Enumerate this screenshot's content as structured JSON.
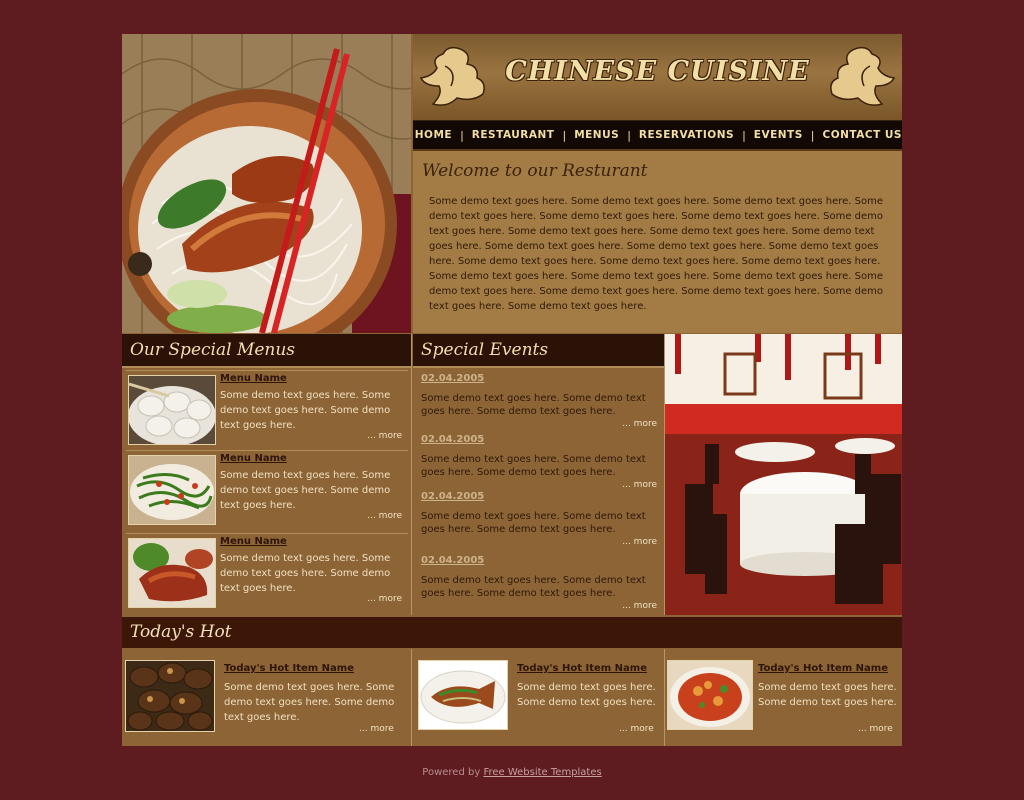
{
  "header": {
    "logo": "CHINESE CUISINE"
  },
  "nav": [
    "HOME",
    "RESTAURANT",
    "MENUS",
    "RESERVATIONS",
    "EVENTS",
    "CONTACT US"
  ],
  "welcome": {
    "title": "Welcome to our Resturant",
    "text": "Some demo text goes here. Some demo text goes here. Some demo text goes here. Some demo text goes here. Some demo text goes here. Some demo text goes here. Some demo text goes here. Some demo text goes here. Some demo text goes here. Some demo text goes here. Some demo text goes here. Some demo text goes here. Some demo text goes here. Some demo text goes here. Some demo text goes here. Some demo text goes here. Some demo text goes here. Some demo text goes here. Some demo text goes here. Some demo text goes here. Some demo text goes here. Some demo text goes here. Some demo text goes here. Some demo text goes here."
  },
  "special_menus": {
    "title": "Our Special Menus",
    "items": [
      {
        "name": "Menu Name",
        "text": "Some demo text goes here. Some demo text goes here. Some demo text goes here.",
        "more": "... more",
        "image": "dumplings-photo"
      },
      {
        "name": "Menu Name",
        "text": "Some demo text goes here. Some demo text goes here. Some demo text goes here.",
        "more": "... more",
        "image": "stir-fried-greens-photo"
      },
      {
        "name": "Menu Name",
        "text": "Some demo text goes here. Some demo text goes here. Some demo text goes here.",
        "more": "... more",
        "image": "roast-duck-photo"
      }
    ]
  },
  "special_events": {
    "title": "Special Events",
    "items": [
      {
        "date": "02.04.2005",
        "text": "Some demo text goes here. Some demo text goes here. Some demo text goes here.",
        "more": "... more"
      },
      {
        "date": "02.04.2005",
        "text": "Some demo text goes here. Some demo text goes here. Some demo text goes here.",
        "more": "... more"
      },
      {
        "date": "02.04.2005",
        "text": "Some demo text goes here. Some demo text goes here. Some demo text goes here.",
        "more": "... more"
      },
      {
        "date": "02.04.2005",
        "text": "Some demo text goes here. Some demo text goes here. Some demo text goes here.",
        "more": "... more"
      }
    ]
  },
  "todays_hot": {
    "title": "Today's Hot",
    "items": [
      {
        "name": "Today's Hot Item Name",
        "text": "Some demo text goes here. Some demo text goes here. Some demo text goes here.",
        "more": "... more",
        "image": "mushrooms-photo"
      },
      {
        "name": "Today's Hot Item Name",
        "text": "Some demo text goes here. Some demo text goes here.",
        "more": "... more",
        "image": "steamed-fish-photo"
      },
      {
        "name": "Today's Hot Item Name",
        "text": "Some demo text goes here. Some demo text goes here.",
        "more": "... more",
        "image": "soup-bowl-photo"
      }
    ]
  },
  "footer": {
    "prefix": "Powered by",
    "link": "Free Website Templates"
  },
  "colors": {
    "page_bg": "#5e1c21",
    "panel_bg": "#8d6436",
    "header_dark": "#2a1206",
    "nav_text": "#f3dfa4"
  }
}
